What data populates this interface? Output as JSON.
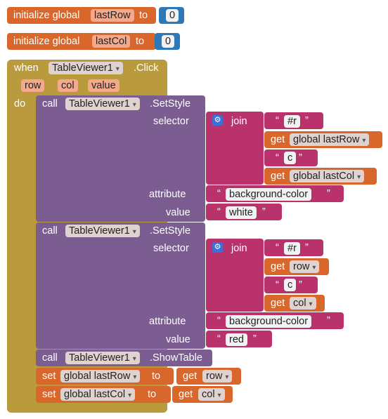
{
  "init_blocks": [
    {
      "prefix": "initialize global",
      "var": "lastRow",
      "to": "to",
      "value": "0"
    },
    {
      "prefix": "initialize global",
      "var": "lastCol",
      "to": "to",
      "value": "0"
    }
  ],
  "event": {
    "when": "when",
    "component": "TableViewer1",
    "event_name": ".Click",
    "params": [
      "row",
      "col",
      "value"
    ],
    "do": "do"
  },
  "setstyle_1": {
    "call": "call",
    "component": "TableViewer1",
    "method": ".SetStyle",
    "selector_label": "selector",
    "join": "join",
    "hash_r": "#r",
    "get": "get",
    "get_var_1": "global lastRow",
    "c": "c",
    "get_var_2": "global lastCol",
    "attribute_label": "attribute",
    "attribute_value": "background-color",
    "value_label": "value",
    "value_value": "white"
  },
  "setstyle_2": {
    "call": "call",
    "component": "TableViewer1",
    "method": ".SetStyle",
    "selector_label": "selector",
    "join": "join",
    "hash_r": "#r",
    "get": "get",
    "get_var_1": "row",
    "c": "c",
    "get_var_2": "col",
    "attribute_label": "attribute",
    "attribute_value": "background-color",
    "value_label": "value",
    "value_value": "red"
  },
  "showtable": {
    "call": "call",
    "component": "TableViewer1",
    "method": ".ShowTable"
  },
  "set_blocks": [
    {
      "set": "set",
      "var": "global lastRow",
      "to": "to",
      "get": "get",
      "src": "row"
    },
    {
      "set": "set",
      "var": "global lastCol",
      "to": "to",
      "get": "get",
      "src": "col"
    }
  ],
  "quote_open": "“",
  "quote_close": "”",
  "colors": {
    "variable_block": "#d9672b",
    "event_block": "#b99b3d",
    "procedure_block": "#7b5d91",
    "text_block": "#b9326c",
    "math_block": "#2d78b7"
  }
}
